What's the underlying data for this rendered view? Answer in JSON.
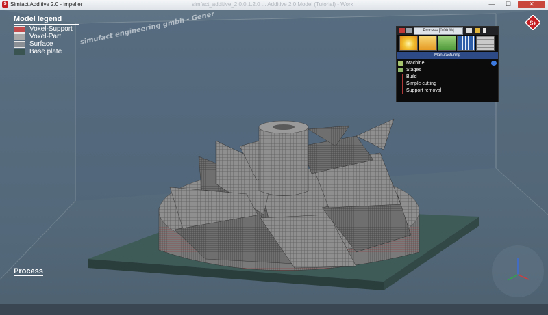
{
  "window": {
    "title": "Simfact Additive 2.0 - impeller",
    "center_title": "simfact_additive_2.0.0.1.2.0 ... Additive 2.0 Model (Tutorial) - Work",
    "minimize": "—",
    "maximize": "☐",
    "close": "✕"
  },
  "legend": {
    "title": "Model legend",
    "items": [
      {
        "label": "Voxel-Support",
        "color": "#c44b4b"
      },
      {
        "label": "Voxel-Part",
        "color": "#a8a8a8"
      },
      {
        "label": "Surface",
        "color": "#8a8f96"
      },
      {
        "label": "Base plate",
        "color": "#3a5451"
      }
    ]
  },
  "watermark": "simufact engineering gmbh - Gener",
  "process_label": "Process",
  "corner_logo": "S+",
  "panel": {
    "progress_label": "Process [0.00 %]",
    "section_label": "Manufacturing",
    "stage_icons": [
      "build-stage-icon",
      "cutting-stage-icon",
      "removal-stage-icon",
      "grid-stage-icon",
      "voxel-stage-icon"
    ],
    "tree": {
      "machine": "Machine",
      "stages": "Stages",
      "stage_items": [
        "Build",
        "Simple cutting",
        "Support removal"
      ]
    }
  },
  "colors": {
    "background": "#5a6f80",
    "base_plate": "#3a5451",
    "part": "#9a9a9a",
    "panel_header": "#2d4a86",
    "accent": "#c41e23"
  }
}
